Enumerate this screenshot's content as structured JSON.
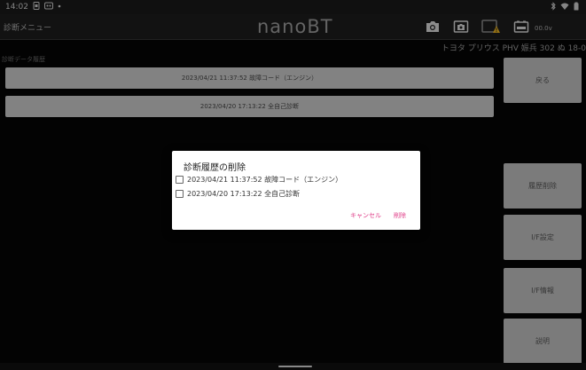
{
  "status_bar": {
    "time": "14:02",
    "left_icons": [
      "sim-icon",
      "notification-icon",
      "dot-icon"
    ],
    "right_icons": [
      "bluetooth-icon",
      "wifi-icon",
      "battery-icon"
    ]
  },
  "app_bar": {
    "menu_title": "診断メニュー",
    "brand": "nanoBT",
    "voltage": "00.0v"
  },
  "vehicle_info": "トヨタ プリウス PHV 娠兵 302 ぬ 18-0",
  "history": {
    "label": "診断データ履歴",
    "items": [
      "2023/04/21 11:37:52 故障コード（エンジン）",
      "2023/04/20 17:13:22 全自己診断"
    ]
  },
  "sidebar": {
    "buttons": [
      "戻る",
      "履歴削除",
      "I/F設定",
      "I/F情報",
      "説明"
    ]
  },
  "dialog": {
    "title": "診断履歴の削除",
    "items": [
      "2023/04/21 11:37:52 故障コード（エンジン）",
      "2023/04/20 17:13:22 全自己診断"
    ],
    "cancel_label": "キャンセル",
    "delete_label": "削除",
    "accent_color": "#e0408a"
  }
}
